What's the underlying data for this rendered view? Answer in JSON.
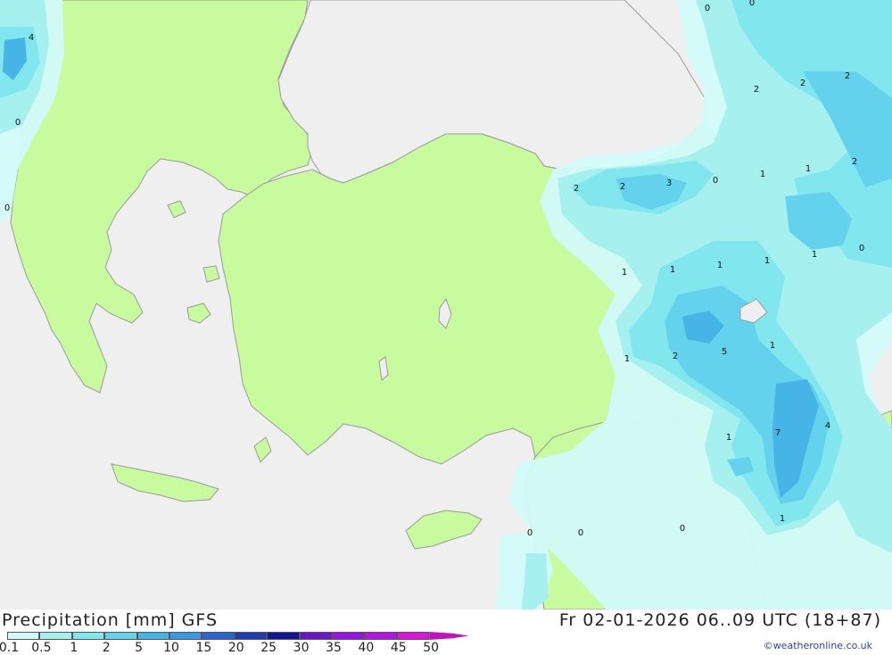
{
  "title": "Precipitation [mm] GFS",
  "datetime": "Fr 02-01-2026 06..09 UTC (18+87)",
  "credit": "©weatheronline.co.uk",
  "colors": {
    "sea": "#efefef",
    "land": "#c8fa9e",
    "border": "#9a9a9a",
    "light_blue": "#d2fafa",
    "cyan": "#a6f0f0",
    "mid_cyan": "#82e6ee",
    "blue": "#64d2ec",
    "deep_blue": "#46b4e6"
  },
  "legend": {
    "labels": [
      "0.1",
      "0.5",
      "1",
      "2",
      "5",
      "10",
      "15",
      "20",
      "25",
      "30",
      "35",
      "40",
      "45",
      "50"
    ],
    "colors": [
      "#d2fafa",
      "#a6f0f0",
      "#82e6ee",
      "#64d2ec",
      "#46b4e6",
      "#3c96e6",
      "#2864d2",
      "#1e3cb4",
      "#141496",
      "#6e14c8",
      "#9614e6",
      "#b414e6",
      "#dc14dc",
      "#be14be"
    ]
  },
  "map_labels": [
    "4",
    "0",
    "0",
    "0",
    "0",
    "2",
    "2",
    "2",
    "2",
    "2",
    "2",
    "3",
    "0",
    "1",
    "1",
    "0",
    "1",
    "1",
    "1",
    "1",
    "5",
    "1",
    "2",
    "1",
    "7",
    "4",
    "1",
    "1",
    "0",
    "0",
    "0",
    "1"
  ]
}
